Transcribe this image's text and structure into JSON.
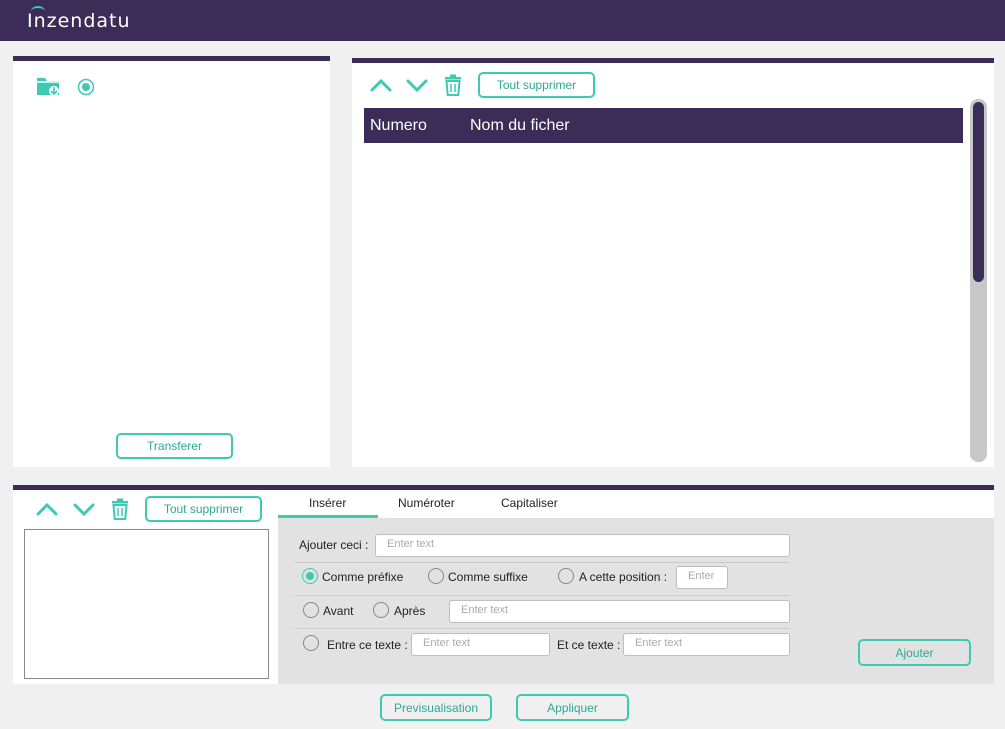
{
  "app": {
    "logo": "Inzendatu"
  },
  "left_panel": {
    "transfer_label": "Transferer"
  },
  "file_panel": {
    "clear_all_label": "Tout supprimer",
    "columns": [
      "Numero",
      "Nom du ficher"
    ]
  },
  "bottom_panel": {
    "clear_all_label": "Tout supprimer",
    "tabs": [
      "Insérer",
      "Numéroter",
      "Capitaliser"
    ],
    "active_tab": "Insérer",
    "add_this_label": "Ajouter ceci :",
    "add_this_placeholder": "Enter text",
    "prefix_label": "Comme préfixe",
    "suffix_label": "Comme suffixe",
    "position_label": "A cette position :",
    "position_placeholder": "Enter",
    "before_label": "Avant",
    "after_label": "Après",
    "before_after_placeholder": "Enter text",
    "between_label": "Entre ce texte :",
    "between_placeholder": "Enter text",
    "and_label": "Et ce texte :",
    "and_placeholder": "Enter text",
    "add_button": "Ajouter",
    "selected_option": "Comme préfixe"
  },
  "footer": {
    "preview_label": "Previsualisation",
    "apply_label": "Appliquer"
  },
  "colors": {
    "brand": "#3b2d57",
    "accent": "#3ec9b3"
  },
  "icons": [
    "folder-download-icon",
    "radio-target-icon",
    "chevron-up-icon",
    "chevron-down-icon",
    "trash-icon"
  ]
}
